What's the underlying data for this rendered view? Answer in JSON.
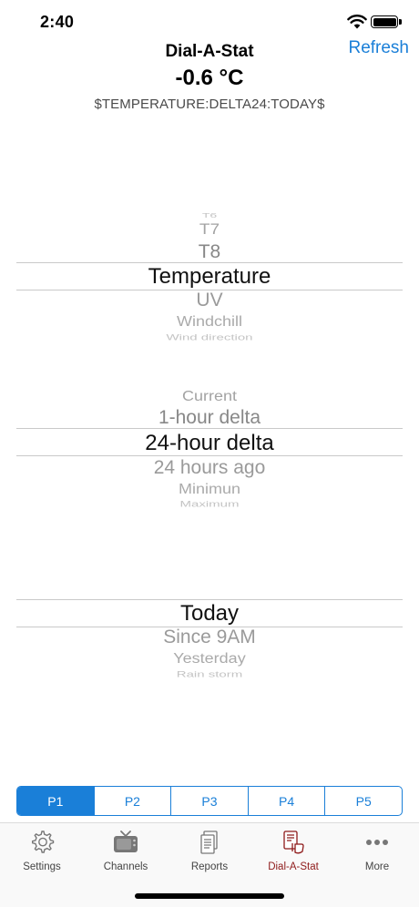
{
  "status_bar": {
    "time": "2:40"
  },
  "header": {
    "title": "Dial-A-Stat",
    "refresh_label": "Refresh",
    "value": "-0.6 °C",
    "token": "$TEMPERATURE:DELTA24:TODAY$"
  },
  "pickers": {
    "measurement": {
      "items": [
        "T6",
        "T7",
        "T8",
        "Temperature",
        "UV",
        "Windchill",
        "Wind direction"
      ],
      "selected": "Temperature"
    },
    "statistic": {
      "items": [
        "Current",
        "1-hour delta",
        "24-hour delta",
        "24 hours ago",
        "Minimun",
        "Maximum"
      ],
      "selected": "24-hour delta"
    },
    "period": {
      "items": [
        "Today",
        "Since 9AM",
        "Yesterday",
        "Rain storm"
      ],
      "selected": "Today"
    }
  },
  "segments": {
    "items": [
      "P1",
      "P2",
      "P3",
      "P4",
      "P5"
    ],
    "selected": "P1"
  },
  "tabbar": {
    "tabs": [
      {
        "label": "Settings",
        "icon": "gear-icon"
      },
      {
        "label": "Channels",
        "icon": "tv-icon"
      },
      {
        "label": "Reports",
        "icon": "document-icon"
      },
      {
        "label": "Dial-A-Stat",
        "icon": "dial-a-stat-icon"
      },
      {
        "label": "More",
        "icon": "ellipsis-icon"
      }
    ],
    "selected": "Dial-A-Stat"
  },
  "colors": {
    "accent": "#1a7fd8",
    "active_tab": "#8e1a1a"
  }
}
